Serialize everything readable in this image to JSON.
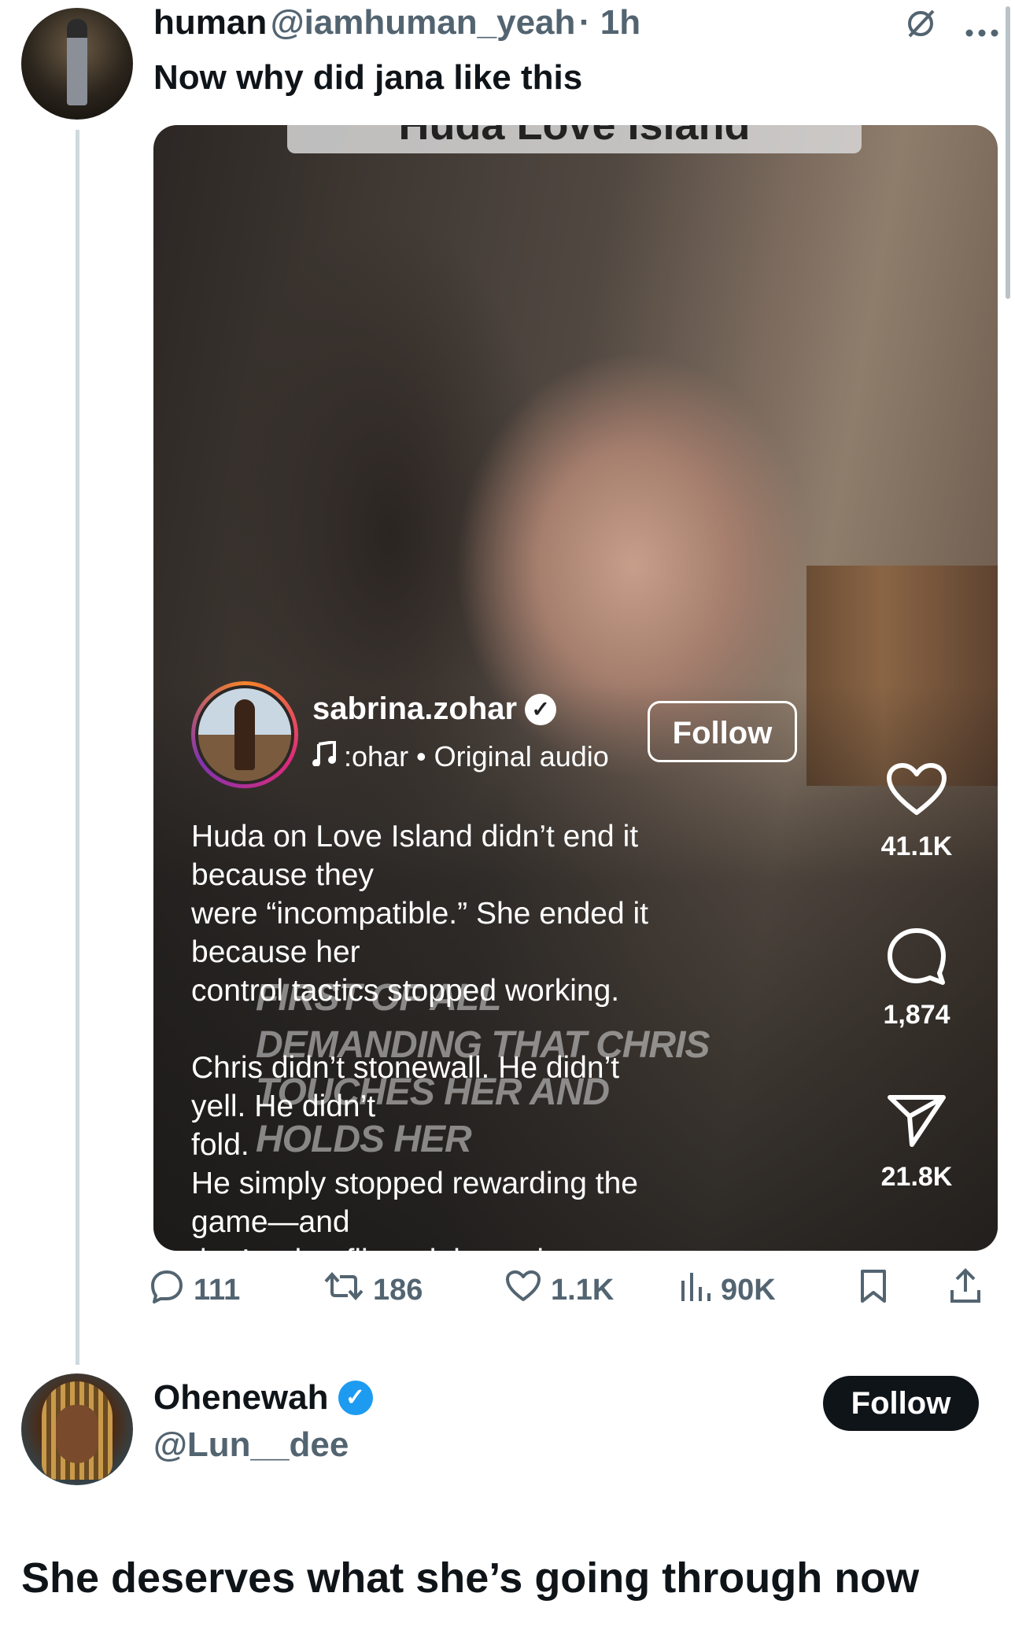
{
  "tweet": {
    "author_name": "human",
    "author_handle": "@iamhuman_yeah",
    "time": "· 1h",
    "text": "Now why did jana like this",
    "icons": [
      "grok-icon",
      "more-icon"
    ]
  },
  "reel": {
    "top_label": "Huda Love Island",
    "username": "sabrina.zohar",
    "audio": ":ohar • Original audio",
    "follow_label": "Follow",
    "caption": "Huda on Love Island didn’t end it because they\nwere “incompatible.” She ended it because her\ncontrol tactics stopped working.\n\nChris didn’t stonewall. He didn’t yell. He didn’t\nfold.\nHe simply stopped rewarding the game—and\nthat’s what flipped the script.\n\nThis is what happens when emotional\nmanipulation gets repackaged as vulnerability.",
    "overlay_text": "FIRST OF ALL DEMANDING THAT CHRIS TOUCHES HER AND HOLDS HER",
    "likes": "41.1K",
    "comments": "1,874",
    "shares": "21.8K"
  },
  "actions": {
    "replies": "111",
    "reposts": "186",
    "likes": "1.1K",
    "views": "90K"
  },
  "reply": {
    "author_name": "Ohenewah",
    "author_handle": "@Lun__dee",
    "follow_label": "Follow",
    "text": "She deserves what she’s going through now"
  },
  "colors": {
    "verified_blue": "#1d9bf0",
    "secondary_text": "#536471",
    "thread_line": "#cfd9de"
  }
}
